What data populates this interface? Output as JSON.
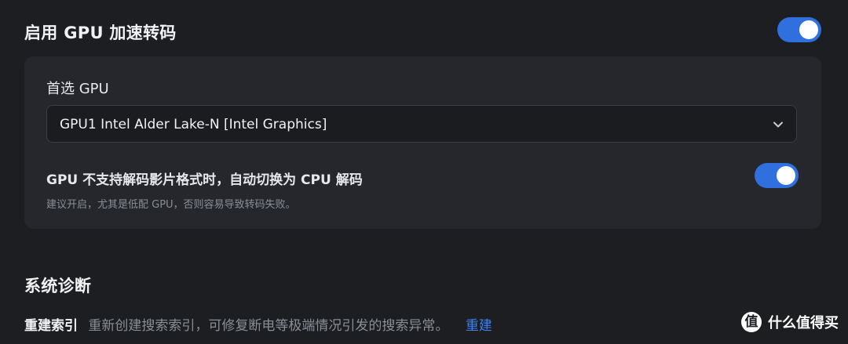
{
  "gpu_section": {
    "title": "启用 GPU 加速转码",
    "enabled": true
  },
  "gpu_card": {
    "preferred_label": "首选 GPU",
    "preferred_value": "GPU1 Intel Alder Lake-N [Intel Graphics]",
    "fallback_title": "GPU 不支持解码影片格式时，自动切换为 CPU 解码",
    "fallback_desc": "建议开启，尤其是低配 GPU，否则容易导致转码失败。",
    "fallback_enabled": true
  },
  "diagnose_section": {
    "title": "系统诊断",
    "rebuild_label": "重建索引",
    "rebuild_desc": "重新创建搜索索引，可修复断电等极端情况引发的搜索异常。",
    "rebuild_link": "重建"
  },
  "watermark": {
    "logo_char": "值",
    "text": "什么值得买"
  },
  "colors": {
    "accent": "#2f6fde",
    "link": "#3b82f6",
    "background": "#1c1e22",
    "card": "#25272c"
  }
}
